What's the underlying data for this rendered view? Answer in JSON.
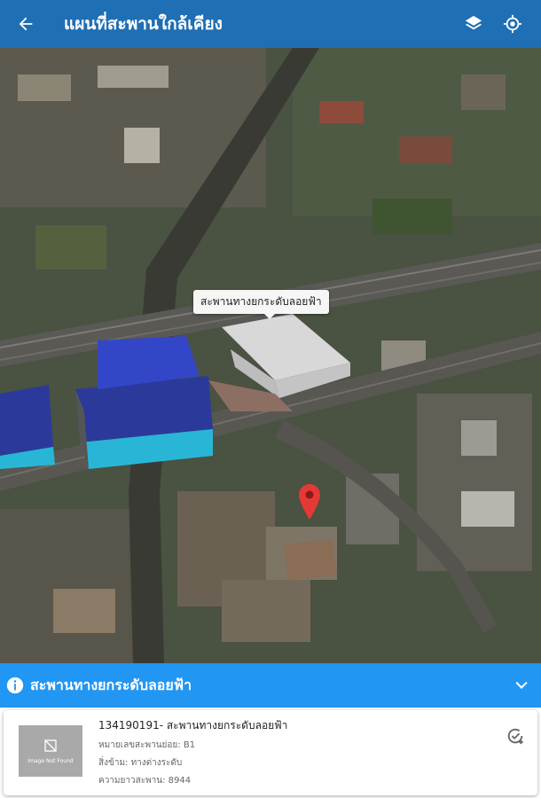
{
  "appbar": {
    "title": "แผนที่สะพานใกล้เคียง",
    "back_icon": "arrow-back-icon",
    "layers_icon": "layers-icon",
    "location_icon": "my-location-icon"
  },
  "map": {
    "label": "สะพานทางยกระดับลอยฟ้า",
    "pin_color": "#e53935",
    "fab_color": "#1e88e5"
  },
  "panel": {
    "title": "สะพานทางยกระดับลอยฟ้า",
    "color": "#2196f3"
  },
  "card": {
    "image_text": "Image Not Found",
    "name": "134190191- สะพานทางยกระดับลอยฟ้า",
    "line1": "หมายเลขสะพานย่อย: B1",
    "line2": "สิ่งข้าม: ทางต่างระดับ",
    "line3": "ความยาวสะพาน: 8944"
  }
}
